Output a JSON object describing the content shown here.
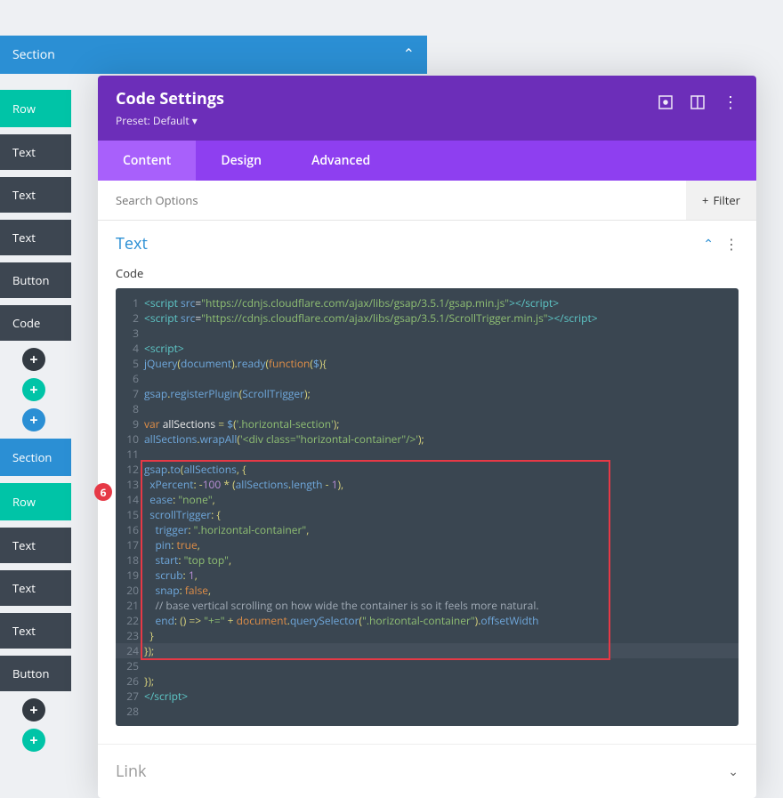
{
  "sidebar": {
    "sectionHeader": "Section",
    "row1": "Row",
    "row2": "Row",
    "items": [
      "Text",
      "Text",
      "Text",
      "Button",
      "Code"
    ],
    "section2": "Section",
    "items2": [
      "Text",
      "Text",
      "Text",
      "Button"
    ],
    "badge": "6"
  },
  "panel": {
    "title": "Code Settings",
    "preset": "Preset: Default ▾",
    "tabs": [
      "Content",
      "Design",
      "Advanced"
    ],
    "activeTab": 0,
    "searchPlaceholder": "Search Options",
    "filterLabel": "Filter",
    "sectionTitle": "Text",
    "fieldLabel": "Code",
    "linkTitle": "Link"
  },
  "code": {
    "lines": [
      {
        "n": 1,
        "segs": [
          {
            "t": "<script ",
            "c": "tAqua"
          },
          {
            "t": "src",
            "c": "tBlue"
          },
          {
            "t": "=",
            "c": "tWhite"
          },
          {
            "t": "\"https://cdnjs.cloudflare.com/ajax/libs/gsap/3.5.1/gsap.min.js\"",
            "c": "tGreen"
          },
          {
            "t": "></script>",
            "c": "tAqua"
          }
        ]
      },
      {
        "n": 2,
        "segs": [
          {
            "t": "<script ",
            "c": "tAqua"
          },
          {
            "t": "src",
            "c": "tBlue"
          },
          {
            "t": "=",
            "c": "tWhite"
          },
          {
            "t": "\"https://cdnjs.cloudflare.com/ajax/libs/gsap/3.5.1/ScrollTrigger.min.js\"",
            "c": "tGreen"
          },
          {
            "t": "></script>",
            "c": "tAqua"
          }
        ]
      },
      {
        "n": 3,
        "segs": []
      },
      {
        "n": 4,
        "segs": [
          {
            "t": "<script>",
            "c": "tAqua"
          }
        ]
      },
      {
        "n": 5,
        "segs": [
          {
            "t": "jQuery",
            "c": "tBlue2"
          },
          {
            "t": "(",
            "c": "tYellow"
          },
          {
            "t": "document",
            "c": "tBlue2"
          },
          {
            "t": ").",
            "c": "tYellow"
          },
          {
            "t": "ready",
            "c": "tBlue2"
          },
          {
            "t": "(",
            "c": "tYellow"
          },
          {
            "t": "function",
            "c": "tOrange"
          },
          {
            "t": "(",
            "c": "tYellow"
          },
          {
            "t": "$",
            "c": "tBlue2"
          },
          {
            "t": "){",
            "c": "tYellow"
          }
        ]
      },
      {
        "n": 6,
        "segs": []
      },
      {
        "n": 7,
        "segs": [
          {
            "t": "gsap",
            "c": "tBlue2"
          },
          {
            "t": ".",
            "c": "tYellow"
          },
          {
            "t": "registerPlugin",
            "c": "tBlue2"
          },
          {
            "t": "(",
            "c": "tYellow"
          },
          {
            "t": "ScrollTrigger",
            "c": "tBlue2"
          },
          {
            "t": ");",
            "c": "tYellow"
          }
        ]
      },
      {
        "n": 8,
        "segs": []
      },
      {
        "n": 9,
        "segs": [
          {
            "t": "var ",
            "c": "tOrange"
          },
          {
            "t": "allSections",
            "c": "tWhite"
          },
          {
            "t": " = ",
            "c": "tYellow"
          },
          {
            "t": "$",
            "c": "tBlue2"
          },
          {
            "t": "(",
            "c": "tYellow"
          },
          {
            "t": "'.horizontal-section'",
            "c": "tGreen"
          },
          {
            "t": ");",
            "c": "tYellow"
          }
        ]
      },
      {
        "n": 10,
        "segs": [
          {
            "t": "allSections",
            "c": "tBlue2"
          },
          {
            "t": ".",
            "c": "tYellow"
          },
          {
            "t": "wrapAll",
            "c": "tBlue2"
          },
          {
            "t": "(",
            "c": "tYellow"
          },
          {
            "t": "'<div class=\"horizontal-container\"/>'",
            "c": "tGreen"
          },
          {
            "t": ");",
            "c": "tYellow"
          }
        ]
      },
      {
        "n": 11,
        "segs": []
      },
      {
        "n": 12,
        "segs": [
          {
            "t": "gsap",
            "c": "tBlue2"
          },
          {
            "t": ".",
            "c": "tYellow"
          },
          {
            "t": "to",
            "c": "tBlue2"
          },
          {
            "t": "(",
            "c": "tYellow"
          },
          {
            "t": "allSections",
            "c": "tBlue2"
          },
          {
            "t": ", {",
            "c": "tYellow"
          }
        ]
      },
      {
        "n": 13,
        "segs": [
          {
            "t": "  xPercent",
            "c": "tBlue2"
          },
          {
            "t": ": ",
            "c": "tYellow"
          },
          {
            "t": "-",
            "c": "tYellow"
          },
          {
            "t": "100",
            "c": "tPurple"
          },
          {
            "t": " * (",
            "c": "tYellow"
          },
          {
            "t": "allSections",
            "c": "tBlue2"
          },
          {
            "t": ".",
            "c": "tYellow"
          },
          {
            "t": "length",
            "c": "tBlue2"
          },
          {
            "t": " - ",
            "c": "tYellow"
          },
          {
            "t": "1",
            "c": "tPurple"
          },
          {
            "t": "),",
            "c": "tYellow"
          }
        ]
      },
      {
        "n": 14,
        "segs": [
          {
            "t": "  ease",
            "c": "tBlue2"
          },
          {
            "t": ": ",
            "c": "tYellow"
          },
          {
            "t": "\"none\"",
            "c": "tGreen"
          },
          {
            "t": ",",
            "c": "tYellow"
          }
        ]
      },
      {
        "n": 15,
        "segs": [
          {
            "t": "  scrollTrigger",
            "c": "tBlue2"
          },
          {
            "t": ": {",
            "c": "tYellow"
          }
        ]
      },
      {
        "n": 16,
        "segs": [
          {
            "t": "    trigger",
            "c": "tBlue2"
          },
          {
            "t": ": ",
            "c": "tYellow"
          },
          {
            "t": "\".horizontal-container\"",
            "c": "tGreen"
          },
          {
            "t": ",",
            "c": "tYellow"
          }
        ]
      },
      {
        "n": 17,
        "segs": [
          {
            "t": "    pin",
            "c": "tBlue2"
          },
          {
            "t": ": ",
            "c": "tYellow"
          },
          {
            "t": "true",
            "c": "tOrange"
          },
          {
            "t": ",",
            "c": "tYellow"
          }
        ]
      },
      {
        "n": 18,
        "segs": [
          {
            "t": "    start",
            "c": "tBlue2"
          },
          {
            "t": ": ",
            "c": "tYellow"
          },
          {
            "t": "\"top top\"",
            "c": "tGreen"
          },
          {
            "t": ",",
            "c": "tYellow"
          }
        ]
      },
      {
        "n": 19,
        "segs": [
          {
            "t": "    scrub",
            "c": "tBlue2"
          },
          {
            "t": ": ",
            "c": "tYellow"
          },
          {
            "t": "1",
            "c": "tPurple"
          },
          {
            "t": ",",
            "c": "tYellow"
          }
        ]
      },
      {
        "n": 20,
        "segs": [
          {
            "t": "    snap",
            "c": "tBlue2"
          },
          {
            "t": ": ",
            "c": "tYellow"
          },
          {
            "t": "false",
            "c": "tOrange"
          },
          {
            "t": ",",
            "c": "tYellow"
          }
        ]
      },
      {
        "n": 21,
        "segs": [
          {
            "t": "    // base vertical scrolling on how wide the container is so it feels more natural.",
            "c": "tGray"
          }
        ]
      },
      {
        "n": 22,
        "segs": [
          {
            "t": "    end",
            "c": "tBlue2"
          },
          {
            "t": ": () => ",
            "c": "tYellow"
          },
          {
            "t": "\"+=\"",
            "c": "tGreen"
          },
          {
            "t": " + ",
            "c": "tYellow"
          },
          {
            "t": "document",
            "c": "tOrange"
          },
          {
            "t": ".",
            "c": "tYellow"
          },
          {
            "t": "querySelector",
            "c": "tBlue2"
          },
          {
            "t": "(",
            "c": "tYellow"
          },
          {
            "t": "\".horizontal-container\"",
            "c": "tGreen"
          },
          {
            "t": ").",
            "c": "tYellow"
          },
          {
            "t": "offsetWidth",
            "c": "tBlue2"
          }
        ]
      },
      {
        "n": 23,
        "segs": [
          {
            "t": "  }",
            "c": "tYellow"
          }
        ]
      },
      {
        "n": 24,
        "hl": true,
        "segs": [
          {
            "t": "});",
            "c": "tYellow"
          }
        ]
      },
      {
        "n": 25,
        "segs": []
      },
      {
        "n": 26,
        "segs": [
          {
            "t": "});",
            "c": "tYellow"
          }
        ]
      },
      {
        "n": 27,
        "segs": [
          {
            "t": "</script>",
            "c": "tAqua"
          }
        ]
      },
      {
        "n": 28,
        "segs": []
      }
    ],
    "highlightBox": {
      "startLine": 12,
      "endLine": 24
    }
  }
}
